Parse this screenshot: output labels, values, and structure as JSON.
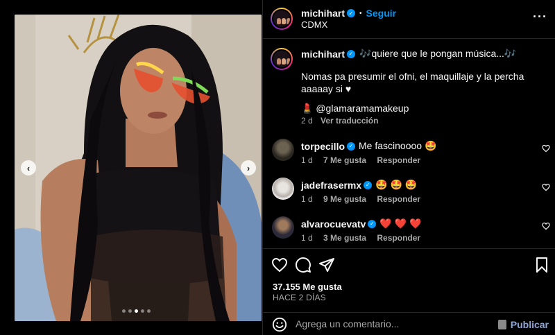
{
  "post": {
    "username": "michihart",
    "follow_label": "Seguir",
    "location": "CDMX",
    "more_label": "···",
    "carousel_dots": 5,
    "carousel_active": 2
  },
  "caption": {
    "username": "michihart",
    "headline": "🎶quiere que le pongan música...🎶",
    "body": "Nomas pa presumir el ofni, el maquillaje y la percha aaaaay si ♥",
    "mention": "💄 @glamaramamakeup",
    "time": "2 d",
    "translate_label": "Ver traducción"
  },
  "comments": [
    {
      "username": "torpecillo",
      "text": "Me fascinoooo 🤩",
      "time": "1 d",
      "likes": "7 Me gusta",
      "reply": "Responder"
    },
    {
      "username": "jadefrasermx",
      "text": "🤩 🤩 🤩",
      "time": "1 d",
      "likes": "9 Me gusta",
      "reply": "Responder"
    },
    {
      "username": "alvarocuevatv",
      "text": "❤️ ❤️ ❤️",
      "time": "1 d",
      "likes": "3 Me gusta",
      "reply": "Responder"
    }
  ],
  "stats": {
    "likes": "37.155 Me gusta",
    "time_ago": "HACE 2 DÍAS"
  },
  "composer": {
    "placeholder": "Agrega un comentario...",
    "publish_label": "Publicar"
  },
  "colors": {
    "link": "#0095f6",
    "muted": "#a8a8a8",
    "border": "#262626",
    "publish": "#8ea7d6"
  },
  "icons": [
    "chevron-left-icon",
    "chevron-right-icon",
    "more-icon",
    "verified-icon",
    "heart-icon",
    "comment-icon",
    "share-icon",
    "bookmark-icon",
    "emoji-icon",
    "lock-icon"
  ]
}
